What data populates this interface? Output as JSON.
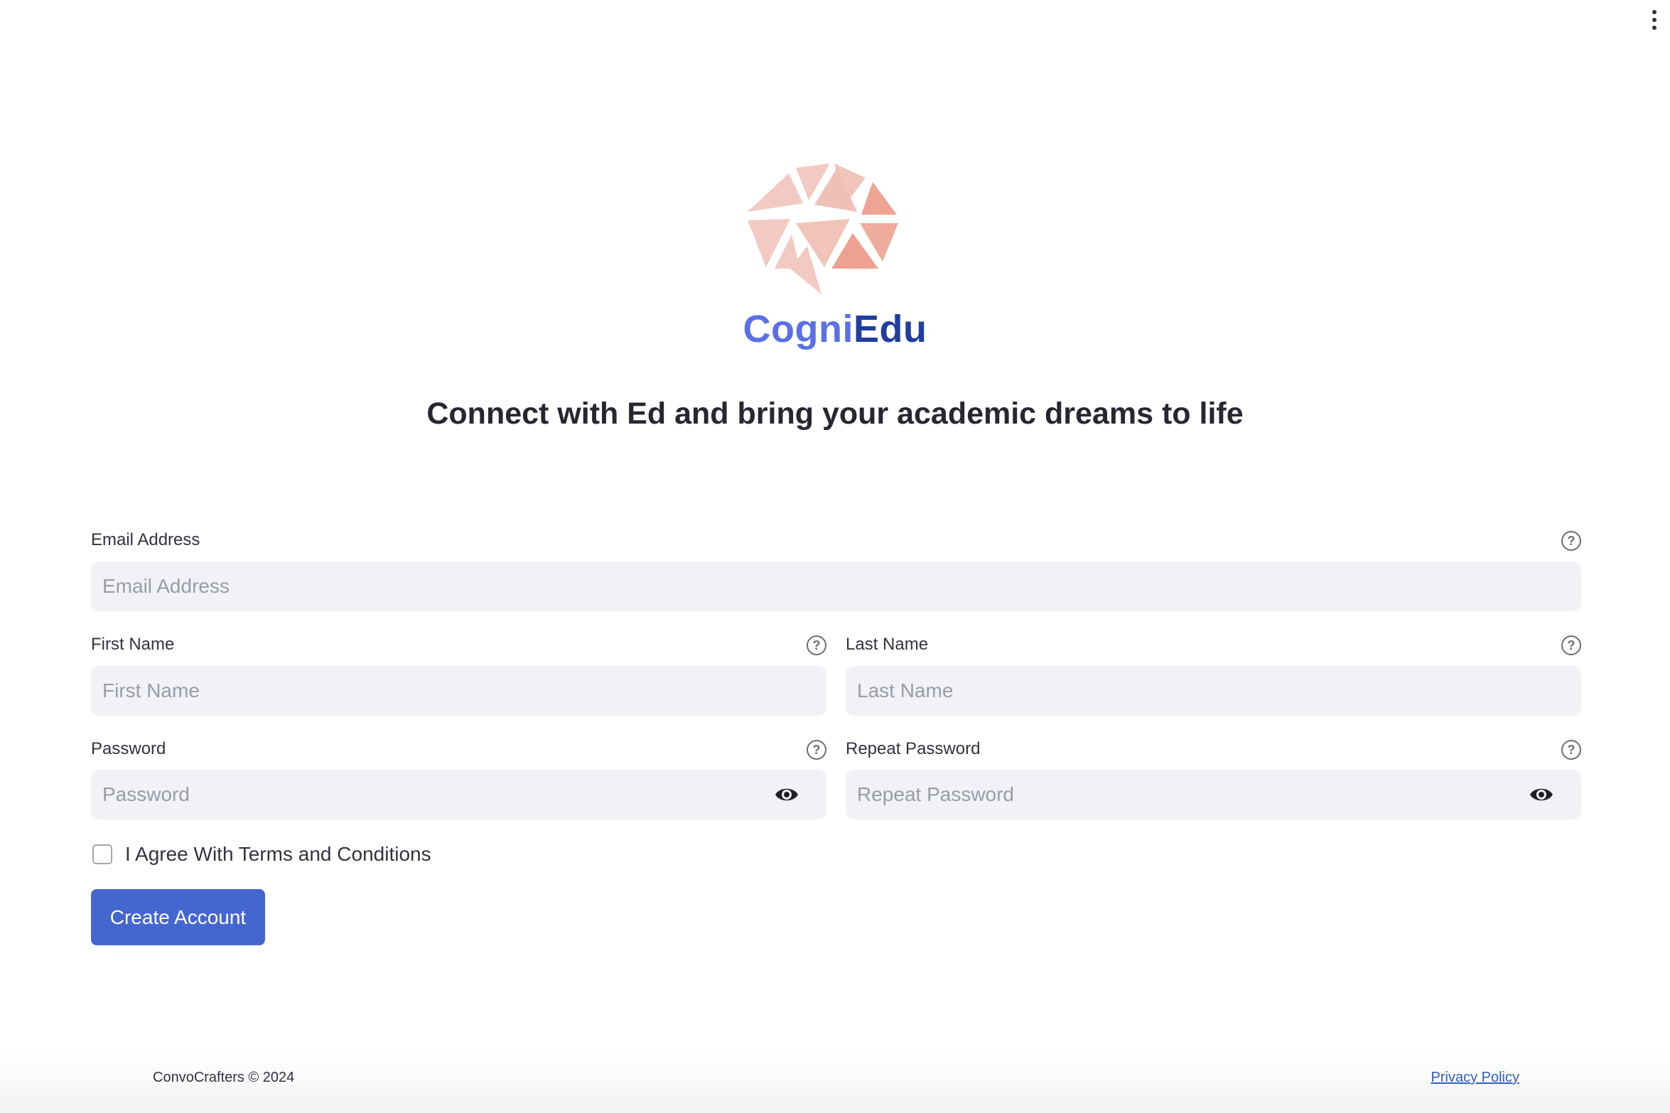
{
  "brand": {
    "part1": "Cogni",
    "part2": "Edu"
  },
  "tagline": "Connect with Ed and bring your academic dreams to life",
  "form": {
    "email": {
      "label": "Email Address",
      "placeholder": "Email Address"
    },
    "first_name": {
      "label": "First Name",
      "placeholder": "First Name"
    },
    "last_name": {
      "label": "Last Name",
      "placeholder": "Last Name"
    },
    "password": {
      "label": "Password",
      "placeholder": "Password"
    },
    "repeat_password": {
      "label": "Repeat Password",
      "placeholder": "Repeat Password"
    },
    "help_glyph": "?",
    "terms_label": "I Agree With Terms and Conditions",
    "terms_checked": false,
    "submit_label": "Create Account"
  },
  "footer": {
    "copyright": "ConvoCrafters © 2024",
    "privacy_link": "Privacy Policy"
  },
  "icons": {
    "menu": "more-vertical-icon",
    "help": "question-circle-icon",
    "eye": "eye-icon",
    "logo": "brain-icon"
  },
  "colors": {
    "brand_light": "#5b6fe6",
    "brand_dark": "#1f3e9e",
    "button": "#4466cf",
    "input_bg": "#f0f2f6",
    "link": "#2f5fc1",
    "logo_light": "#f2c9c0",
    "logo_dark": "#efa090"
  }
}
